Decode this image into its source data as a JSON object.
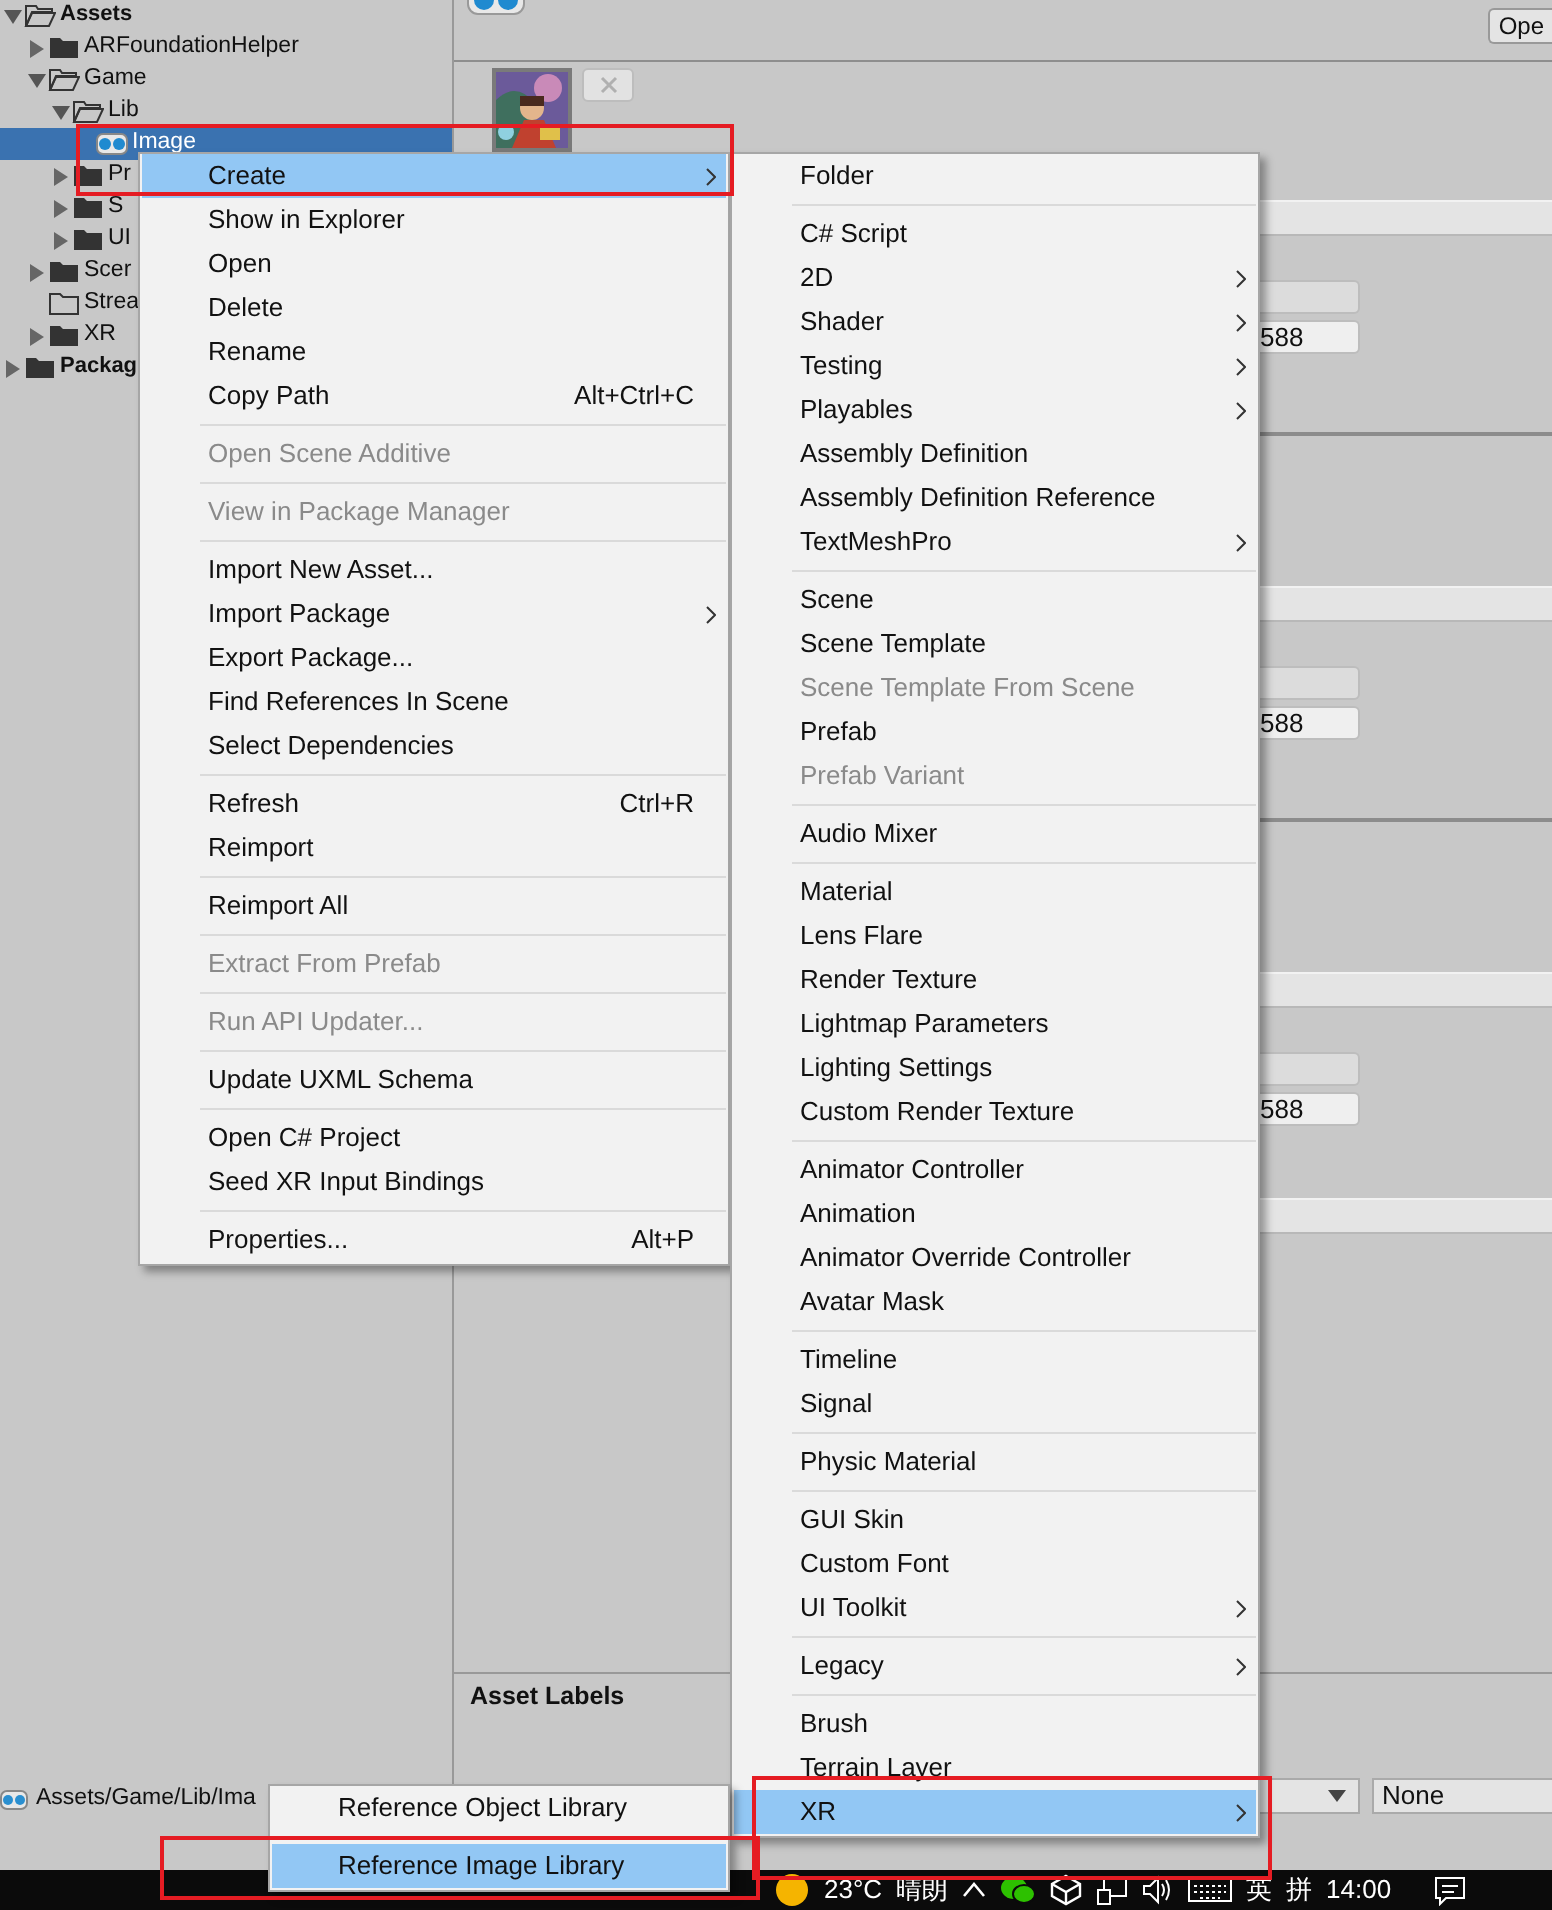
{
  "project_tree": [
    {
      "label": "Assets",
      "kind": "folder",
      "expanded": true,
      "selected": false,
      "children": [
        {
          "label": "ARFoundationHelper",
          "kind": "folder",
          "expanded": false,
          "selected": false
        },
        {
          "label": "Game",
          "kind": "folder",
          "expanded": true,
          "selected": false,
          "children": [
            {
              "label": "Lib",
              "kind": "folder",
              "expanded": true,
              "selected": false,
              "children": [
                {
                  "label": "Image",
                  "kind": "asset",
                  "selected": true
                }
              ]
            },
            {
              "label": "Pr",
              "kind": "folder",
              "expanded": false,
              "selected": false
            },
            {
              "label": "S",
              "kind": "folder",
              "expanded": false,
              "selected": false
            },
            {
              "label": "UI",
              "kind": "folder",
              "expanded": false,
              "selected": false
            }
          ]
        },
        {
          "label": "Scer",
          "kind": "folder",
          "expanded": false,
          "selected": false
        },
        {
          "label": "Strea",
          "kind": "empty-folder",
          "selected": false
        },
        {
          "label": "XR",
          "kind": "folder",
          "expanded": false,
          "selected": false
        }
      ]
    },
    {
      "label": "Packag",
      "kind": "folder",
      "expanded": false,
      "selected": false
    }
  ],
  "inspector": {
    "open_button": "Ope",
    "sections": [
      {
        "value": "588"
      },
      {
        "value": "588"
      },
      {
        "value": "588"
      }
    ],
    "asset_labels": "Asset Labels",
    "bundle_variant": "None"
  },
  "status_bar": {
    "path": "Assets/Game/Lib/Ima"
  },
  "context_menu": [
    {
      "kind": "item",
      "label": "Create",
      "submenu": true,
      "disabled": false,
      "selected": true
    },
    {
      "kind": "item",
      "label": "Show in Explorer",
      "submenu": false,
      "disabled": false,
      "selected": false
    },
    {
      "kind": "item",
      "label": "Open",
      "submenu": false,
      "disabled": false,
      "selected": false
    },
    {
      "kind": "item",
      "label": "Delete",
      "submenu": false,
      "disabled": false,
      "selected": false
    },
    {
      "kind": "item",
      "label": "Rename",
      "submenu": false,
      "disabled": false,
      "selected": false
    },
    {
      "kind": "item",
      "label": "Copy Path",
      "shortcut": "Alt+Ctrl+C",
      "submenu": false,
      "disabled": false,
      "selected": false
    },
    {
      "kind": "separator"
    },
    {
      "kind": "item",
      "label": "Open Scene Additive",
      "submenu": false,
      "disabled": true,
      "selected": false
    },
    {
      "kind": "separator"
    },
    {
      "kind": "item",
      "label": "View in Package Manager",
      "submenu": false,
      "disabled": true,
      "selected": false
    },
    {
      "kind": "separator"
    },
    {
      "kind": "item",
      "label": "Import New Asset...",
      "submenu": false,
      "disabled": false,
      "selected": false
    },
    {
      "kind": "item",
      "label": "Import Package",
      "submenu": true,
      "disabled": false,
      "selected": false
    },
    {
      "kind": "item",
      "label": "Export Package...",
      "submenu": false,
      "disabled": false,
      "selected": false
    },
    {
      "kind": "item",
      "label": "Find References In Scene",
      "submenu": false,
      "disabled": false,
      "selected": false
    },
    {
      "kind": "item",
      "label": "Select Dependencies",
      "submenu": false,
      "disabled": false,
      "selected": false
    },
    {
      "kind": "separator"
    },
    {
      "kind": "item",
      "label": "Refresh",
      "shortcut": "Ctrl+R",
      "submenu": false,
      "disabled": false,
      "selected": false
    },
    {
      "kind": "item",
      "label": "Reimport",
      "submenu": false,
      "disabled": false,
      "selected": false
    },
    {
      "kind": "separator"
    },
    {
      "kind": "item",
      "label": "Reimport All",
      "submenu": false,
      "disabled": false,
      "selected": false
    },
    {
      "kind": "separator"
    },
    {
      "kind": "item",
      "label": "Extract From Prefab",
      "submenu": false,
      "disabled": true,
      "selected": false
    },
    {
      "kind": "separator"
    },
    {
      "kind": "item",
      "label": "Run API Updater...",
      "submenu": false,
      "disabled": true,
      "selected": false
    },
    {
      "kind": "separator"
    },
    {
      "kind": "item",
      "label": "Update UXML Schema",
      "submenu": false,
      "disabled": false,
      "selected": false
    },
    {
      "kind": "separator"
    },
    {
      "kind": "item",
      "label": "Open C# Project",
      "submenu": false,
      "disabled": false,
      "selected": false
    },
    {
      "kind": "item",
      "label": "Seed XR Input Bindings",
      "submenu": false,
      "disabled": false,
      "selected": false
    },
    {
      "kind": "separator"
    },
    {
      "kind": "item",
      "label": "Properties...",
      "shortcut": "Alt+P",
      "submenu": false,
      "disabled": false,
      "selected": false
    }
  ],
  "create_menu": [
    {
      "kind": "item",
      "label": "Folder",
      "submenu": false,
      "disabled": false,
      "selected": false
    },
    {
      "kind": "separator"
    },
    {
      "kind": "item",
      "label": "C# Script",
      "submenu": false,
      "disabled": false,
      "selected": false
    },
    {
      "kind": "item",
      "label": "2D",
      "submenu": true,
      "disabled": false,
      "selected": false
    },
    {
      "kind": "item",
      "label": "Shader",
      "submenu": true,
      "disabled": false,
      "selected": false
    },
    {
      "kind": "item",
      "label": "Testing",
      "submenu": true,
      "disabled": false,
      "selected": false
    },
    {
      "kind": "item",
      "label": "Playables",
      "submenu": true,
      "disabled": false,
      "selected": false
    },
    {
      "kind": "item",
      "label": "Assembly Definition",
      "submenu": false,
      "disabled": false,
      "selected": false
    },
    {
      "kind": "item",
      "label": "Assembly Definition Reference",
      "submenu": false,
      "disabled": false,
      "selected": false
    },
    {
      "kind": "item",
      "label": "TextMeshPro",
      "submenu": true,
      "disabled": false,
      "selected": false
    },
    {
      "kind": "separator"
    },
    {
      "kind": "item",
      "label": "Scene",
      "submenu": false,
      "disabled": false,
      "selected": false
    },
    {
      "kind": "item",
      "label": "Scene Template",
      "submenu": false,
      "disabled": false,
      "selected": false
    },
    {
      "kind": "item",
      "label": "Scene Template From Scene",
      "submenu": false,
      "disabled": true,
      "selected": false
    },
    {
      "kind": "item",
      "label": "Prefab",
      "submenu": false,
      "disabled": false,
      "selected": false
    },
    {
      "kind": "item",
      "label": "Prefab Variant",
      "submenu": false,
      "disabled": true,
      "selected": false
    },
    {
      "kind": "separator"
    },
    {
      "kind": "item",
      "label": "Audio Mixer",
      "submenu": false,
      "disabled": false,
      "selected": false
    },
    {
      "kind": "separator"
    },
    {
      "kind": "item",
      "label": "Material",
      "submenu": false,
      "disabled": false,
      "selected": false
    },
    {
      "kind": "item",
      "label": "Lens Flare",
      "submenu": false,
      "disabled": false,
      "selected": false
    },
    {
      "kind": "item",
      "label": "Render Texture",
      "submenu": false,
      "disabled": false,
      "selected": false
    },
    {
      "kind": "item",
      "label": "Lightmap Parameters",
      "submenu": false,
      "disabled": false,
      "selected": false
    },
    {
      "kind": "item",
      "label": "Lighting Settings",
      "submenu": false,
      "disabled": false,
      "selected": false
    },
    {
      "kind": "item",
      "label": "Custom Render Texture",
      "submenu": false,
      "disabled": false,
      "selected": false
    },
    {
      "kind": "separator"
    },
    {
      "kind": "item",
      "label": "Animator Controller",
      "submenu": false,
      "disabled": false,
      "selected": false
    },
    {
      "kind": "item",
      "label": "Animation",
      "submenu": false,
      "disabled": false,
      "selected": false
    },
    {
      "kind": "item",
      "label": "Animator Override Controller",
      "submenu": false,
      "disabled": false,
      "selected": false
    },
    {
      "kind": "item",
      "label": "Avatar Mask",
      "submenu": false,
      "disabled": false,
      "selected": false
    },
    {
      "kind": "separator"
    },
    {
      "kind": "item",
      "label": "Timeline",
      "submenu": false,
      "disabled": false,
      "selected": false
    },
    {
      "kind": "item",
      "label": "Signal",
      "submenu": false,
      "disabled": false,
      "selected": false
    },
    {
      "kind": "separator"
    },
    {
      "kind": "item",
      "label": "Physic Material",
      "submenu": false,
      "disabled": false,
      "selected": false
    },
    {
      "kind": "separator"
    },
    {
      "kind": "item",
      "label": "GUI Skin",
      "submenu": false,
      "disabled": false,
      "selected": false
    },
    {
      "kind": "item",
      "label": "Custom Font",
      "submenu": false,
      "disabled": false,
      "selected": false
    },
    {
      "kind": "item",
      "label": "UI Toolkit",
      "submenu": true,
      "disabled": false,
      "selected": false
    },
    {
      "kind": "separator"
    },
    {
      "kind": "item",
      "label": "Legacy",
      "submenu": true,
      "disabled": false,
      "selected": false
    },
    {
      "kind": "separator"
    },
    {
      "kind": "item",
      "label": "Brush",
      "submenu": false,
      "disabled": false,
      "selected": false
    },
    {
      "kind": "item",
      "label": "Terrain Layer",
      "submenu": false,
      "disabled": false,
      "selected": false
    },
    {
      "kind": "item",
      "label": "XR",
      "submenu": true,
      "disabled": false,
      "selected": true
    }
  ],
  "xr_menu": [
    {
      "kind": "item",
      "label": "Reference Object Library",
      "submenu": false,
      "disabled": false,
      "selected": false
    },
    {
      "kind": "separator"
    },
    {
      "kind": "item",
      "label": "Reference Image Library",
      "submenu": false,
      "disabled": false,
      "selected": true
    }
  ],
  "taskbar": {
    "temperature": "23°C",
    "weather": "晴朗",
    "input_language": "英",
    "input_mode": "拼",
    "clock": "14:00"
  }
}
